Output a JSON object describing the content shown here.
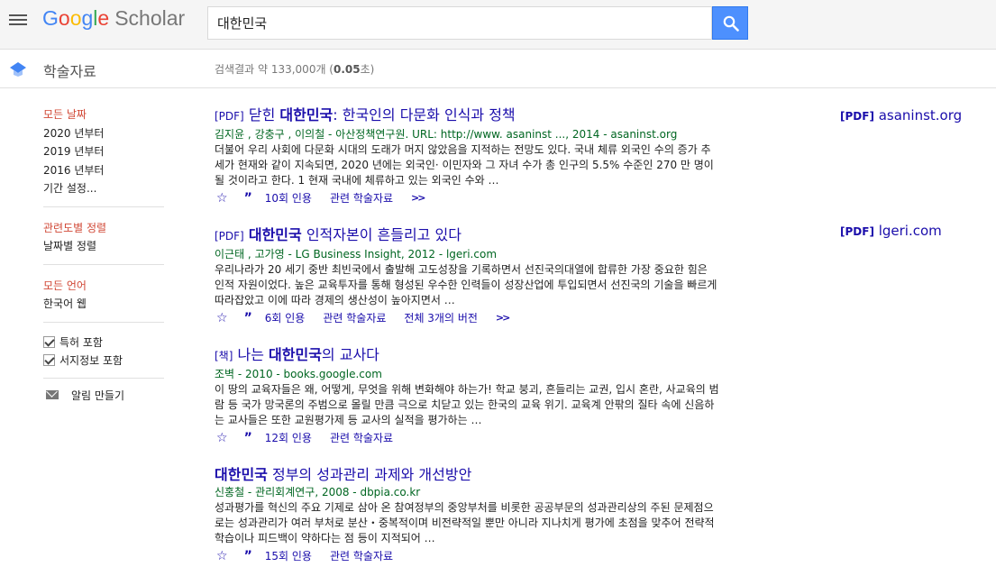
{
  "header": {
    "logo_google": [
      "G",
      "o",
      "o",
      "g",
      "l",
      "e"
    ],
    "logo_scholar": "Scholar",
    "search_value": "대한민국"
  },
  "subhead": {
    "section_title": "학술자료",
    "stats_prefix": "검색결과 약 133,000개 (",
    "stats_time": "0.05",
    "stats_suffix": "초)"
  },
  "sidebar": {
    "date_filters": [
      "모든 날짜",
      "2020 년부터",
      "2019 년부터",
      "2016 년부터",
      "기간 설정..."
    ],
    "sort_options": [
      "관련도별 정렬",
      "날짜별 정렬"
    ],
    "language_options": [
      "모든 언어",
      "한국어 웹"
    ],
    "checks": [
      "특허 포함",
      "서지정보 포함"
    ],
    "alert": "알림 만들기"
  },
  "results": [
    {
      "tag": "[PDF]",
      "title_pre": "닫힌 ",
      "title_bold": "대한민국",
      "title_post": ": 한국인의 다문화 인식과 정책",
      "meta": "김지윤 ,  강충구 ,  이의철 - 아산정책연구원. URL: http://www. asaninst ..., 2014 - asaninst.org",
      "snippet": "더불어 우리 사회에 다문화 시대의 도래가 머지 않았음을 지적하는 전망도 있다. 국내 체류 외국인 수의 증가 추세가 현재와 같이 지속되면, 2020 년에는 외국인· 이민자와 그 자녀 수가 총 인구의 5.5% 수준인 270 만 명이 될 것이라고 한다. 1 현재 국내에 체류하고 있는 외국인 수와 …",
      "cited": "10회 인용",
      "related": "관련 학술자료",
      "versions": "",
      "side_tag": "[PDF]",
      "side_domain": "asaninst.org"
    },
    {
      "tag": "[PDF]",
      "title_pre": "",
      "title_bold": "대한민국",
      "title_post": " 인적자본이 흔들리고 있다",
      "meta": "이근태 ,  고가영 - LG Business Insight, 2012 - lgeri.com",
      "snippet": "우리나라가 20 세기 중반 최빈국에서 출발해 고도성장을 기록하면서 선진국의대열에 합류한 가장 중요한 힘은 인적 자원이었다. 높은 교육투자를 통해 형성된 우수한 인력들이 성장산업에 투입되면서 선진국의 기술을 빠르게 따라잡았고 이에 따라 경제의 생산성이 높아지면서 …",
      "cited": "6회 인용",
      "related": "관련 학술자료",
      "versions": "전체 3개의 버전",
      "side_tag": "[PDF]",
      "side_domain": "lgeri.com"
    },
    {
      "tag": "[책]",
      "title_pre": "나는 ",
      "title_bold": "대한민국",
      "title_post": "의 교사다",
      "meta": "조벽 - 2010 - books.google.com",
      "snippet": "이 땅의 교육자들은 왜, 어떻게, 무엇을 위해 변화해야 하는가! 학교 붕괴, 흔들리는 교권, 입시 혼란, 사교육의 범람 등 국가 망국론의 주범으로 몰릴 만큼 극으로 치닫고 있는 한국의 교육 위기. 교육계 안팎의 질타 속에 신음하는 교사들은 또한 교원평가제 등 교사의 실적을 평가하는 …",
      "cited": "12회 인용",
      "related": "관련 학술자료",
      "versions": "",
      "side_tag": "",
      "side_domain": ""
    },
    {
      "tag": "",
      "title_pre": "",
      "title_bold": "대한민국",
      "title_post": " 정부의 성과관리 과제와 개선방안",
      "meta": "신홍철 - 관리회계연구, 2008 - dbpia.co.kr",
      "snippet": "성과평가를 혁신의 주요 기제로 삼아 온 참여정부의 중앙부처를 비롯한 공공부문의 성과관리상의 주된 문제점으로는 성과관리가 여러 부처로 분산・중복적이며 비전략적일 뿐만 아니라 지나치게 평가에 초점을 맞추어 전략적 학습이나 피드백이 약하다는 점 등이 지적되어 …",
      "cited": "15회 인용",
      "related": "관련 학술자료",
      "versions": "",
      "side_tag": "",
      "side_domain": ""
    }
  ]
}
